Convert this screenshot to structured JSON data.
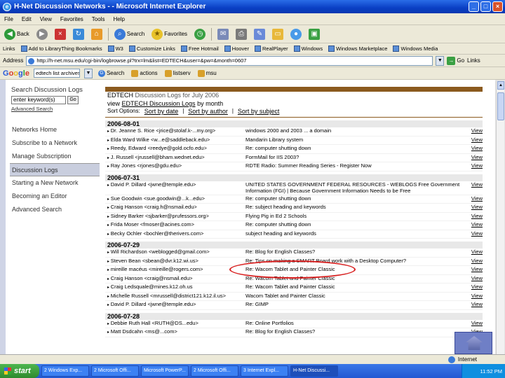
{
  "window": {
    "title": "H-Net Discussion Networks - - Microsoft Internet Explorer",
    "minimize": "_",
    "maximize": "□",
    "close": "×"
  },
  "menu": [
    "File",
    "Edit",
    "View",
    "Favorites",
    "Tools",
    "Help"
  ],
  "toolbar": {
    "back": "Back",
    "search": "Search",
    "favorites": "Favorites"
  },
  "links": [
    "Links",
    "Add to LibraryThing Bookmarks",
    "W3",
    "Customize Links",
    "Free Hotmail",
    "Hoover",
    "RealPlayer",
    "Windows",
    "Windows Marketplace",
    "Windows Media"
  ],
  "address": {
    "label": "Address",
    "url": "http://h-net.msu.edu/cgi-bin/logbrowse.pl?trx=lm&list=EDTECH&user=&pw=&month=0607",
    "go": "Go",
    "links_label": "Links"
  },
  "google": {
    "logo": "Google",
    "query": "edtech list archives",
    "search": "Search",
    "actions": "actions",
    "listserv": "listserv",
    "msu": "msu"
  },
  "sidebar": {
    "search_heading": "Search Discussion Logs",
    "search_value": "enter keyword(s)",
    "go": "Go",
    "advanced": "Advanced Search",
    "items": [
      {
        "label": "Networks Home",
        "active": false
      },
      {
        "label": "Subscribe to a Network",
        "active": false
      },
      {
        "label": "Manage Subscription",
        "active": false
      },
      {
        "label": "Discussion Logs",
        "active": true
      },
      {
        "label": "Starting a New Network",
        "active": false
      },
      {
        "label": "Becoming an Editor",
        "active": false
      },
      {
        "label": "Advanced Search",
        "active": false
      }
    ]
  },
  "main": {
    "title_prefix": "EDTECH ",
    "title_rest": "Discussion Logs for July 2006",
    "view_prefix": "view ",
    "view_link": "EDTECH Discussion Logs",
    "view_suffix": " by month",
    "sort_label": "Sort Options:",
    "sort_by_date": "Sort by date",
    "sort_by_author": "Sort by author",
    "sort_by_subject": "Sort by subject",
    "view_label": "View",
    "days": [
      {
        "date": "2006-08-01",
        "rows": [
          {
            "author": "Dr. Jeanne S. Rice <jrice@stolaf.k-...my.org>",
            "subject": "windows 2000 and 2003 ... a domain"
          },
          {
            "author": "Elda Ward Wilke <w...e@saddleback.edu>",
            "subject": "Mandarin Library system"
          },
          {
            "author": "Reedy, Edward <reedye@gold.ocfo.edu>",
            "subject": "Re: computer shutting down"
          },
          {
            "author": "J. Russell <jrussell@bham.wednet.edu>",
            "subject": "FormMail for IIS 2003?"
          },
          {
            "author": "Ray Jones <rjones@gdu.edu>",
            "subject": "RDTE Radio: Summer Reading Series - Register Now"
          }
        ]
      },
      {
        "date": "2006-07-31",
        "rows": [
          {
            "author": "David P. Dillard <jwne@temple.edu>",
            "subject": "UNITED STATES GOVERNMENT FEDERAL RESOURCES - WEBLOGS Free Government Information (FGI) | Because Government Information Needs to be Free"
          },
          {
            "author": "Sue Goodwin <sue.goodwin@...k...edu>",
            "subject": "Re: computer shutting down"
          },
          {
            "author": "Craig Hanson <craig.h@nsmail.edu>",
            "subject": "Re: subject heading and keywords"
          },
          {
            "author": "Sidney Barker <sjbarker@prufessors.org>",
            "subject": "Flying Pig in Ed 2 Schools"
          },
          {
            "author": "Frida Moser <fmoser@acines.com>",
            "subject": "Re: computer shutting down"
          },
          {
            "author": "Becky Ochler <bochler@therivers.com>",
            "subject": "subject heading and keywords"
          }
        ]
      },
      {
        "date": "2006-07-29",
        "rows": [
          {
            "author": "Will Richardson <weblogged@gmail.com>",
            "subject": "Re: Blog for English Classes?"
          },
          {
            "author": "Steven Bean <sbean@dvr.k12.wi.us>",
            "subject": "Re: Tips on making a SMART Board work with a Desktop Computer?"
          },
          {
            "author": "mireille macéus <mireille@rogers.com>",
            "subject": "Re: Wacom Tablet and Painter Classic"
          },
          {
            "author": "Craig Hanson <craig@nsmail.edu>",
            "subject": "Re: Wacom Tablet and Painter Classic"
          },
          {
            "author": "Craig Ledsquale@mines.k12.oh.us",
            "subject": "Re: Wacom Tablet and Painter Classic"
          },
          {
            "author": "Michelle Russell <mrussell@district121.k12.il.us>",
            "subject": "Wacom Tablet and Painter Classic"
          },
          {
            "author": "David P. Dillard <jwne@temple.edu>",
            "subject": "Re: GIMP"
          }
        ]
      },
      {
        "date": "2006-07-28",
        "rows": [
          {
            "author": "Debbie Ruth Hall <RUTH@DS...edu>",
            "subject": "Re: Online Portfolios"
          },
          {
            "author": "Matt Dsdcahn <ms@...com>",
            "subject": "Re: Blog for English Classes?"
          }
        ]
      }
    ]
  },
  "status": {
    "zone": "Internet"
  },
  "taskbar": {
    "start": "start",
    "tasks": [
      {
        "label": "2 Windows Exp...",
        "active": false
      },
      {
        "label": "2 Microsoft Offi...",
        "active": false
      },
      {
        "label": "Microsoft PowerP...",
        "active": false
      },
      {
        "label": "2 Microsoft Offi...",
        "active": false
      },
      {
        "label": "3 Internet Expl...",
        "active": false
      },
      {
        "label": "H-Net Discussi...",
        "active": true
      }
    ],
    "clock": "11:52 PM"
  },
  "colors": {
    "header_bar": "#8b5a1e",
    "highlight_circle": "#d81e1e",
    "nav_active": "#c9cede"
  }
}
